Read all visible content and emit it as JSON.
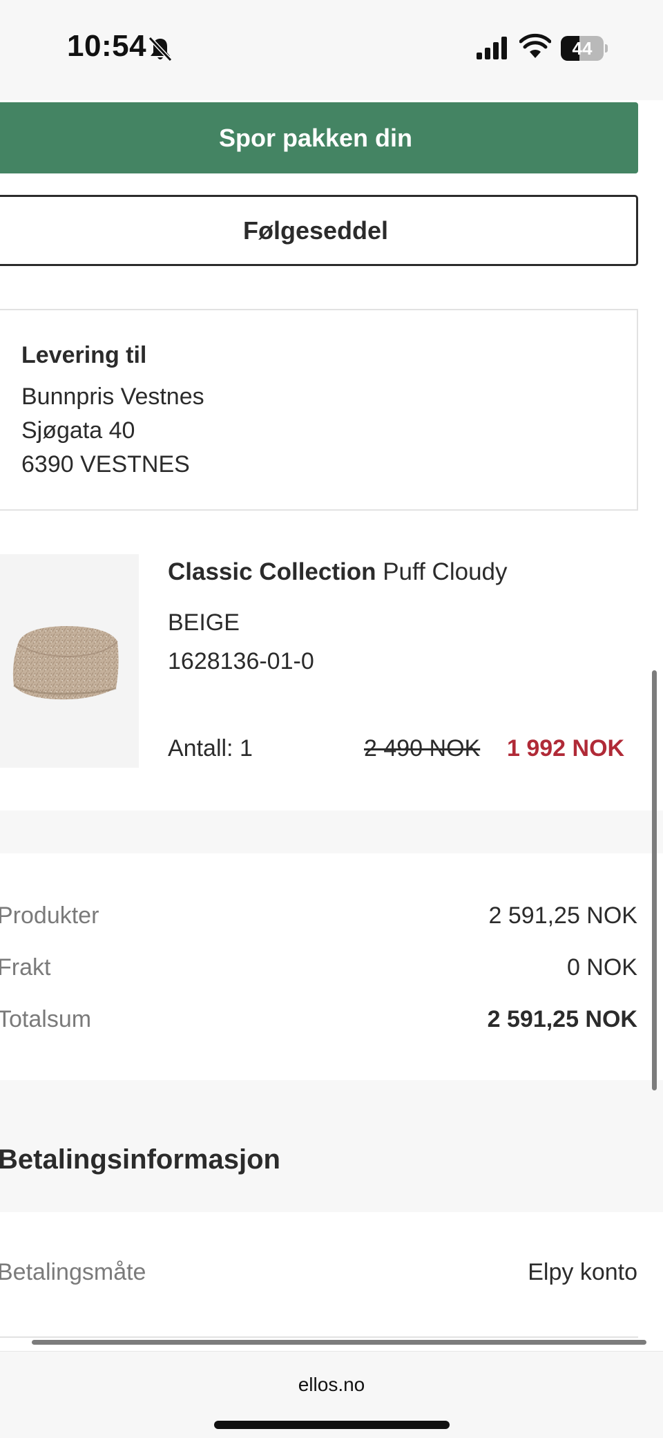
{
  "status_bar": {
    "time": "10:54",
    "battery_level": "44",
    "icons": [
      "bell-slash-icon",
      "cellular-signal-icon",
      "wifi-icon",
      "battery-icon"
    ]
  },
  "actions": {
    "track_package": "Spor pakken din",
    "packing_slip": "Følgeseddel"
  },
  "delivery": {
    "title": "Levering til",
    "name": "Bunnpris Vestnes",
    "street": "Sjøgata 40",
    "postal": "6390 VESTNES"
  },
  "product": {
    "brand": "Classic Collection",
    "name": " Puff Cloudy",
    "color": "BEIGE",
    "sku": "1628136-01-0",
    "quantity": "Antall: 1",
    "old_price": "2 490 NOK",
    "new_price": "1 992 NOK"
  },
  "summary": {
    "rows": [
      {
        "label": "Produkter",
        "value": "2 591,25 NOK"
      },
      {
        "label": "Frakt",
        "value": "0 NOK"
      },
      {
        "label": "Totalsum",
        "value": "2 591,25 NOK"
      }
    ]
  },
  "payment": {
    "title": "Betalingsinformasjon",
    "method_label": "Betalingsmåte",
    "method_value": "Elpy konto"
  },
  "browser": {
    "url": "ellos.no"
  },
  "colors": {
    "primary_green": "#448463",
    "sale_red": "#b02a37",
    "text": "#2b2b2b",
    "muted": "#7a7a7a",
    "band": "#f7f7f7"
  }
}
